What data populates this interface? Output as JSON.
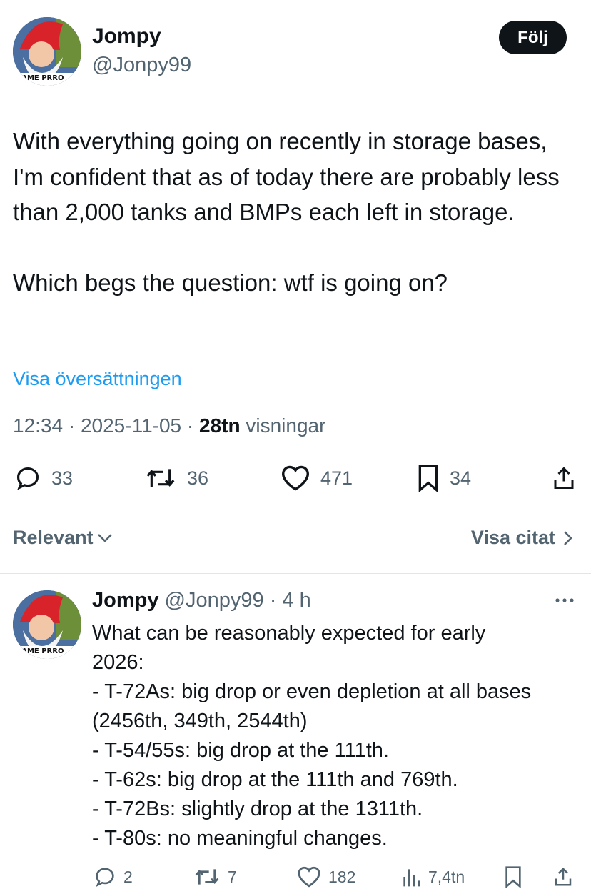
{
  "tweet": {
    "author_name": "Jompy",
    "author_handle": "@Jonpy99",
    "avatar_icon": "gnome-avatar-icon",
    "avatar_banner_text": "GAME PRRO",
    "follow_label": "Följ",
    "text_p1": "With everything going on recently in storage bases, I'm confident that as of today there are probably less than 2,000 tanks and BMPs each left in storage.",
    "text_p2": "Which begs the question: wtf is going on?",
    "translate_label": "Visa översättningen",
    "time": "12:34",
    "date": "2025-11-05",
    "views_count": "28tn",
    "views_label": "visningar",
    "replies": "33",
    "retweets": "36",
    "likes": "471",
    "bookmarks": "34"
  },
  "sort": {
    "label": "Relevant",
    "quotes_label": "Visa citat"
  },
  "reply": {
    "author_name": "Jompy",
    "author_handle": "@Jonpy99",
    "time": "4 h",
    "lines": [
      "What can be reasonably expected for early",
      "2026:",
      "- T-72As: big drop or even depletion at all bases",
      "(2456th, 349th, 2544th)",
      "- T-54/55s: big drop at the 111th.",
      "- T-62s: big drop at the 111th and 769th.",
      "- T-72Bs: slightly drop at the 1311th.",
      "- T-80s: no meaningful changes."
    ],
    "replies": "2",
    "retweets": "7",
    "likes": "182",
    "views": "7,4tn"
  },
  "colors": {
    "text": "#0f1419",
    "secondary": "#536471",
    "link": "#1d9bf0",
    "divider": "#e1e6ea"
  }
}
